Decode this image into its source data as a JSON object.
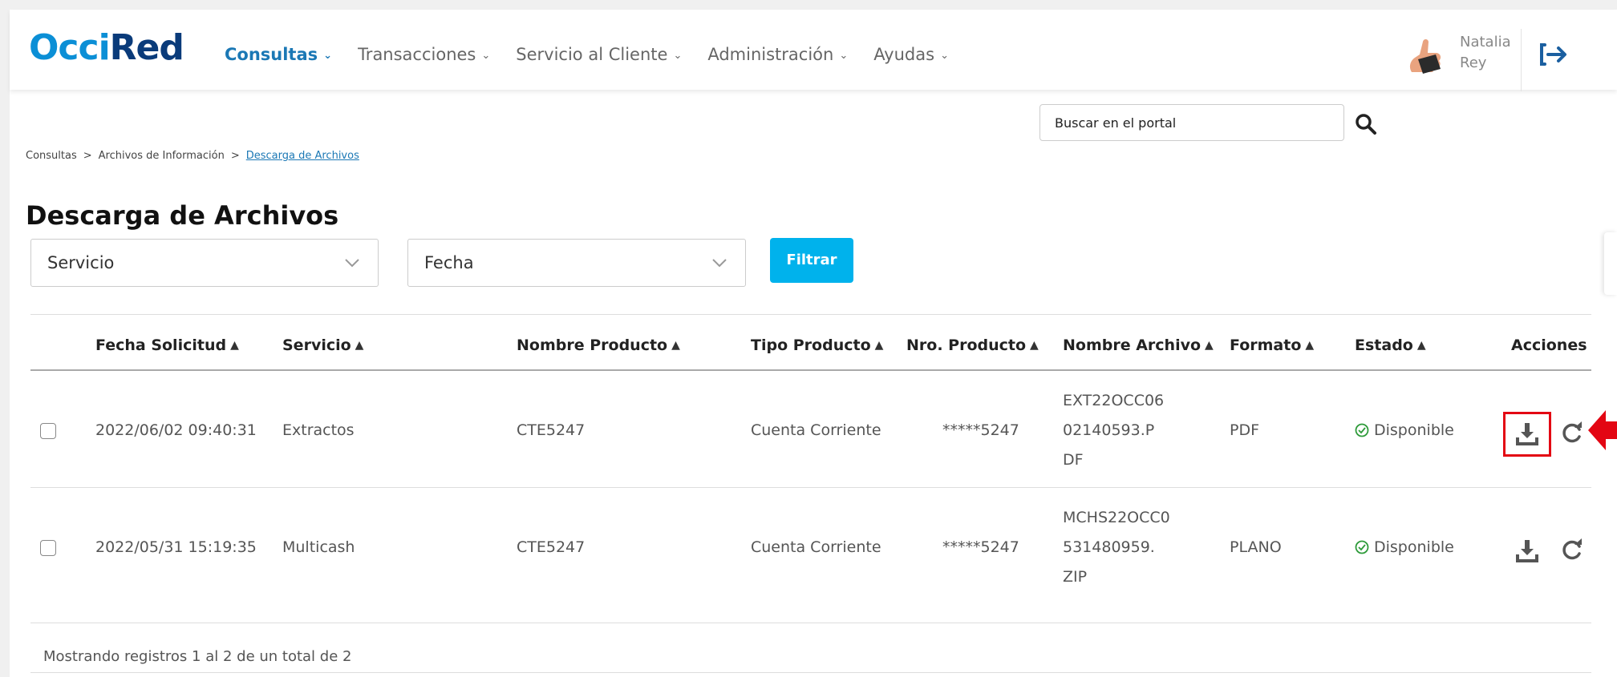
{
  "app": {
    "logo_part1": "Occi",
    "logo_part2": "Red"
  },
  "nav": {
    "items": [
      {
        "label": "Consultas",
        "active": true
      },
      {
        "label": "Transacciones",
        "active": false
      },
      {
        "label": "Servicio al Cliente",
        "active": false
      },
      {
        "label": "Administración",
        "active": false
      },
      {
        "label": "Ayudas",
        "active": false
      }
    ]
  },
  "user": {
    "first_name": "Natalia",
    "last_name": "Rey"
  },
  "search": {
    "placeholder": "Buscar en el portal"
  },
  "breadcrumb": {
    "items": [
      "Consultas",
      "Archivos de Información",
      "Descarga de Archivos"
    ],
    "separator": ">"
  },
  "page": {
    "title": "Descarga de Archivos"
  },
  "filters": {
    "service_value": "Servicio",
    "date_value": "Fecha",
    "filter_button": "Filtrar"
  },
  "table": {
    "columns": [
      "Fecha Solicitud",
      "Servicio",
      "Nombre Producto",
      "Tipo Producto",
      "Nro. Producto",
      "Nombre Archivo",
      "Formato",
      "Estado",
      "Acciones"
    ],
    "rows": [
      {
        "fecha": "2022/06/02 09:40:31",
        "servicio": "Extractos",
        "nombre_producto": "CTE5247",
        "tipo_producto": "Cuenta Corriente",
        "nro_producto": "*****5247",
        "archivo_lines": [
          "EXT22OCC06",
          "02140593.P",
          "DF"
        ],
        "formato": "PDF",
        "estado": "Disponible"
      },
      {
        "fecha": "2022/05/31 15:19:35",
        "servicio": "Multicash",
        "nombre_producto": "CTE5247",
        "tipo_producto": "Cuenta Corriente",
        "nro_producto": "*****5247",
        "archivo_lines": [
          "MCHS22OCC0",
          "531480959.",
          "ZIP"
        ],
        "formato": "PLANO",
        "estado": "Disponible"
      }
    ],
    "footer": "Mostrando registros 1 al 2 de un total de 2"
  },
  "colors": {
    "brand_light": "#0b8fd6",
    "brand_dark": "#0a3b7a",
    "nav_active": "#1b78b5",
    "button": "#00b2ec",
    "status_ok": "#2e9b3a",
    "highlight": "#e30613"
  },
  "icons": {
    "sort": "sort-icon",
    "download": "download-icon",
    "refresh": "refresh-icon",
    "status": "check-circle-icon",
    "logout": "logout-icon",
    "search": "search-icon"
  }
}
